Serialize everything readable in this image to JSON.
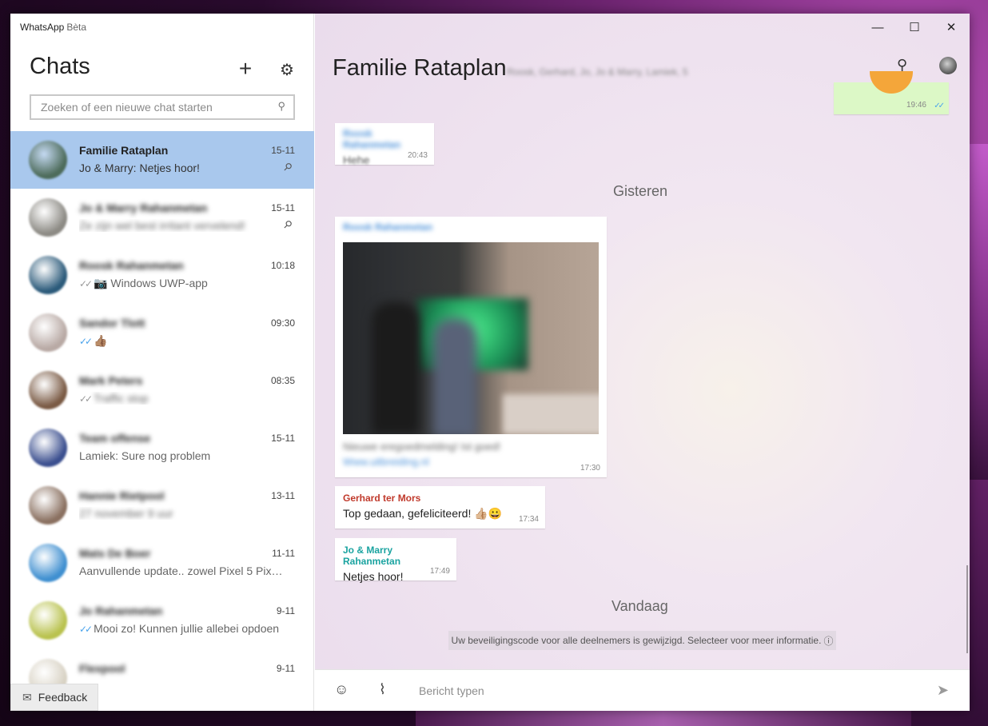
{
  "app": {
    "name": "WhatsApp",
    "badge": "Bèta"
  },
  "sidebar": {
    "title": "Chats",
    "search_placeholder": "Zoeken of een nieuwe chat starten",
    "feedback_label": "Feedback",
    "chats": [
      {
        "name": "Familie Rataplan",
        "preview": "Jo & Marry: Netjes hoor!",
        "time": "15-11",
        "pinned": true,
        "active": true,
        "name_blurred": false,
        "preview_blurred": false,
        "ticks": "",
        "avatar_color": "#4d6b5a"
      },
      {
        "name": "Jo & Marry Rahanmetan",
        "preview": "Ze zijn wel best irritant vervelend!",
        "time": "15-11",
        "pinned": true,
        "active": false,
        "name_blurred": true,
        "preview_blurred": true,
        "ticks": "",
        "avatar_color": "#8c8a84"
      },
      {
        "name": "Roosk Rahanmetan",
        "preview": "📷 Windows UWP-app",
        "time": "10:18",
        "pinned": false,
        "active": false,
        "name_blurred": true,
        "preview_blurred": false,
        "ticks": "grey",
        "avatar_color": "#2b5a7a"
      },
      {
        "name": "Sandor Tlott",
        "preview": "👍🏽",
        "time": "09:30",
        "pinned": false,
        "active": false,
        "name_blurred": true,
        "preview_blurred": false,
        "ticks": "blue",
        "avatar_color": "#b8a9a4"
      },
      {
        "name": "Mark Peters",
        "preview": "Traffic stop",
        "time": "08:35",
        "pinned": false,
        "active": false,
        "name_blurred": true,
        "preview_blurred": true,
        "ticks": "grey",
        "avatar_color": "#7a5a44"
      },
      {
        "name": "Team offense",
        "preview": "Lamiek: Sure nog problem",
        "time": "15-11",
        "pinned": false,
        "active": false,
        "name_blurred": true,
        "preview_blurred": false,
        "ticks": "",
        "avatar_color": "#3b4f8f"
      },
      {
        "name": "Hannie Rietpool",
        "preview": "27 november 9 uur",
        "time": "13-11",
        "pinned": false,
        "active": false,
        "name_blurred": true,
        "preview_blurred": true,
        "ticks": "",
        "avatar_color": "#8a7060"
      },
      {
        "name": "Mats De Boer",
        "preview": "Aanvullende update.. zowel Pixel 5 Pixel 4a",
        "time": "11-11",
        "pinned": false,
        "active": false,
        "name_blurred": true,
        "preview_blurred": false,
        "ticks": "",
        "avatar_color": "#3f8fd0"
      },
      {
        "name": "Jo Rahanmetan",
        "preview": "Mooi zo! Kunnen jullie allebei opdoen",
        "time": "9-11",
        "pinned": false,
        "active": false,
        "name_blurred": true,
        "preview_blurred": false,
        "ticks": "blue",
        "avatar_color": "#b9c24e"
      },
      {
        "name": "Flexpool",
        "preview": "",
        "time": "9-11",
        "pinned": false,
        "active": false,
        "name_blurred": true,
        "preview_blurred": false,
        "ticks": "",
        "avatar_color": "#d8d2c4"
      }
    ]
  },
  "window_controls": {
    "minimize": "—",
    "maximize": "☐",
    "close": "✕"
  },
  "chat": {
    "title": "Familie Rataplan",
    "members": "Roosk, Gerhard, Jo, Jo & Marry, Lamiek, 5",
    "messages": {
      "out_time": "19:46",
      "m1_sender": "Roosk Rahanmetan",
      "m1_text": "Hehe",
      "m1_time": "20:43",
      "date_yesterday": "Gisteren",
      "m2_sender": "Roosk Rahanmetan",
      "m2_caption": "Nieuwe eregoedmelding! Ist goed!",
      "m2_link": "Www.uitbreiding.nl",
      "m2_time": "17:30",
      "m3_sender": "Gerhard ter Mors",
      "m3_text": "Top gedaan, gefeliciteerd! 👍🏼😀",
      "m3_time": "17:34",
      "m4_sender": "Jo & Marry Rahanmetan",
      "m4_text": "Netjes hoor!",
      "m4_time": "17:49",
      "date_today": "Vandaag",
      "system": "Uw beveiligingscode voor alle deelnemers is gewijzigd. Selecteer voor meer informatie."
    },
    "compose_placeholder": "Bericht typen"
  },
  "colors": {
    "active_chat": "#a9c8ed",
    "sender_gerhard": "#c0392b",
    "sender_jo": "#1aa3a0",
    "sender_roosk": "#4a90d9"
  }
}
